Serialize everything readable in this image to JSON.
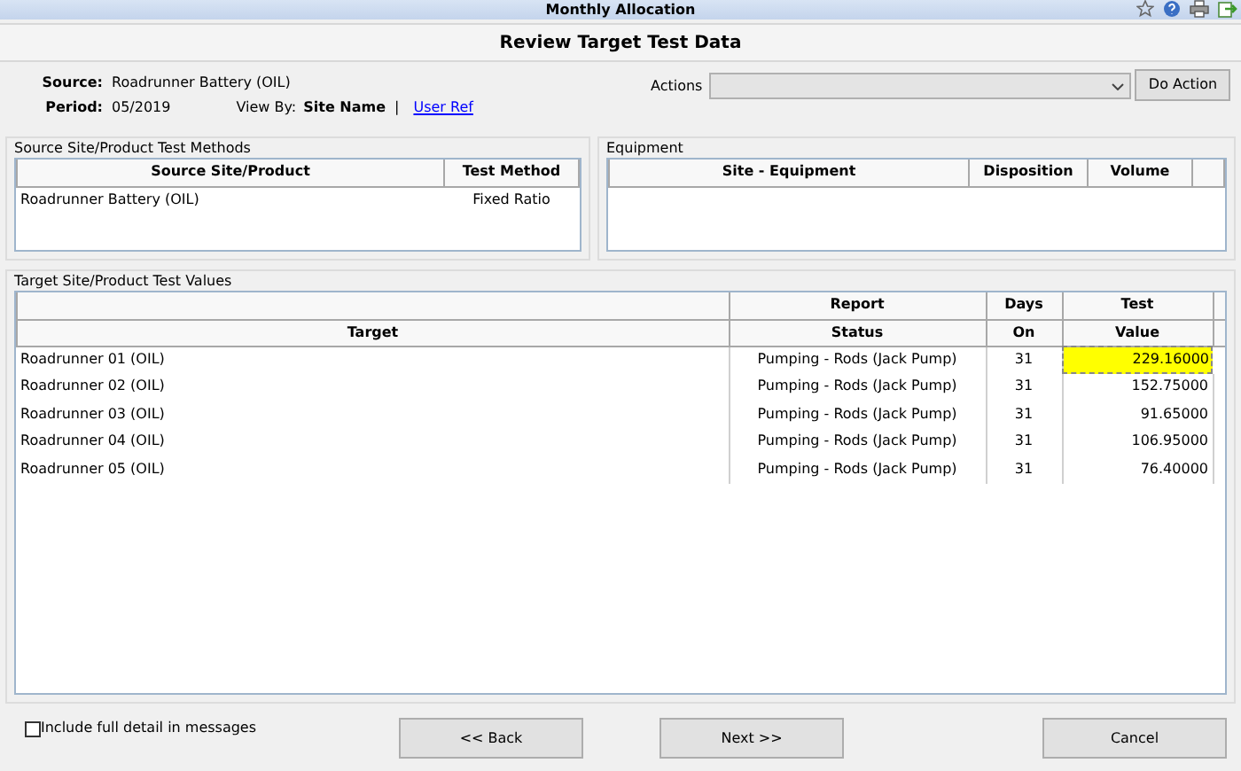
{
  "window": {
    "title": "Monthly Allocation"
  },
  "header": {
    "title": "Review Target Test Data"
  },
  "info": {
    "source_label": "Source:",
    "source": "Roadrunner Battery (OIL)",
    "period_label": "Period:",
    "period": "05/2019",
    "view_by_label": "View By:",
    "view_by_value": "Site Name",
    "separator": "|",
    "view_by_link": "User Ref"
  },
  "actions": {
    "label": "Actions",
    "button": "Do Action"
  },
  "source_methods": {
    "title": "Source Site/Product Test Methods",
    "columns": [
      "Source Site/Product",
      "Test Method"
    ],
    "rows": [
      [
        "Roadrunner Battery (OIL)",
        "Fixed Ratio"
      ]
    ]
  },
  "equipment": {
    "title": "Equipment",
    "columns": [
      "Site - Equipment",
      "Disposition",
      "Volume"
    ]
  },
  "test_values": {
    "title": "Target Site/Product Test Values",
    "header_top": [
      "Report",
      "Days",
      "Test"
    ],
    "columns": [
      "Target",
      "Status",
      "On",
      "Value"
    ],
    "rows": [
      {
        "cells": [
          "Roadrunner 01 (OIL)",
          "Pumping - Rods (Jack Pump)",
          "31",
          "229.16000"
        ],
        "selected": true
      },
      {
        "cells": [
          "Roadrunner 02 (OIL)",
          "Pumping - Rods (Jack Pump)",
          "31",
          "152.75000"
        ],
        "selected": false
      },
      {
        "cells": [
          "Roadrunner 03 (OIL)",
          "Pumping - Rods (Jack Pump)",
          "31",
          "91.65000"
        ],
        "selected": false
      },
      {
        "cells": [
          "Roadrunner 04 (OIL)",
          "Pumping - Rods (Jack Pump)",
          "31",
          "106.95000"
        ],
        "selected": false
      },
      {
        "cells": [
          "Roadrunner 05 (OIL)",
          "Pumping - Rods (Jack Pump)",
          "31",
          "76.40000"
        ],
        "selected": false
      }
    ]
  },
  "footer": {
    "checkbox": {
      "label": "Include full detail in messages",
      "checked": false
    },
    "buttons": [
      "<< Back",
      "Next >>",
      "Cancel"
    ]
  }
}
